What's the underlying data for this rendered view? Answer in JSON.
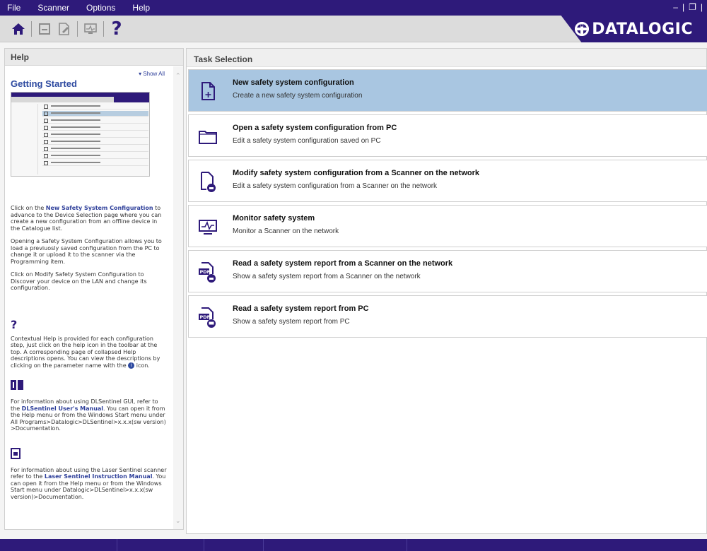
{
  "menu": {
    "items": [
      "File",
      "Scanner",
      "Options",
      "Help"
    ]
  },
  "window": {
    "minimize": "–",
    "restore": "❐",
    "separator": "|"
  },
  "toolbar": {
    "brand": "DATALOGIC"
  },
  "help": {
    "header": "Help",
    "show_all": "Show All",
    "getting_started": "Getting Started",
    "p1_prefix": "Click on the ",
    "p1_bold": "New Safety System Configuration",
    "p1_suffix": " to advance to the Device Selection page where you can create a new configuration from an offline device in the Catalogue list.",
    "p2": "Opening a Safety System Configuration allows you to load a previuosly saved configuration from the PC to change it or upload it to the scanner via the Programming item.",
    "p3": "Click on Modify Safety System Configuration to Discover your device on the LAN and change its configuration.",
    "qmark": "?",
    "p4_prefix": "Contextual Help is provided for each configuration step, just click on the help icon in the toolbar at the top. A corresponding page of collapsed Help descriptions opens. You can view the descriptions by clicking on the parameter name with the ",
    "p4_suffix": " icon.",
    "p5_prefix": "For information about using DLSentinel GUI, refer to the ",
    "p5_bold": "DLSentinel User's Manual",
    "p5_suffix": ". You can open it from the Help menu or from the Windows Start menu under All Programs>Datalogic>DLSentinel>x.x.x(sw version) >Documentation.",
    "p6_prefix": "For information about using the Laser Sentinel scanner refer to the ",
    "p6_bold": "Laser Sentinel Instruction Manual",
    "p6_suffix": ". You can open it from the Help menu or from the Windows Start menu under Datalogic>DLSentinel>x.x.x(sw version)>Documentation."
  },
  "tasks": {
    "header": "Task Selection",
    "items": [
      {
        "title": "New safety system configuration",
        "desc": "Create a new safety system configuration",
        "icon": "new-document-icon",
        "selected": true
      },
      {
        "title": "Open a safety system configuration from PC",
        "desc": "Edit a safety system configuration saved on PC",
        "icon": "folder-icon",
        "selected": false
      },
      {
        "title": "Modify safety system configuration from a Scanner on the network",
        "desc": "Edit a safety system configuration from a Scanner on the network",
        "icon": "document-scanner-icon",
        "selected": false
      },
      {
        "title": "Monitor safety system",
        "desc": "Monitor a Scanner on the network",
        "icon": "monitor-icon",
        "selected": false
      },
      {
        "title": "Read a safety system report from a Scanner on the network",
        "desc": "Show a safety system report from a Scanner on the network",
        "icon": "pdf-scanner-icon",
        "selected": false
      },
      {
        "title": "Read a safety system report from PC",
        "desc": "Show a safety system report from PC",
        "icon": "pdf-pc-icon",
        "selected": false
      }
    ]
  },
  "colors": {
    "accent": "#2e1a7a",
    "selected": "#a9c6e1",
    "link": "#2e4aa0"
  }
}
